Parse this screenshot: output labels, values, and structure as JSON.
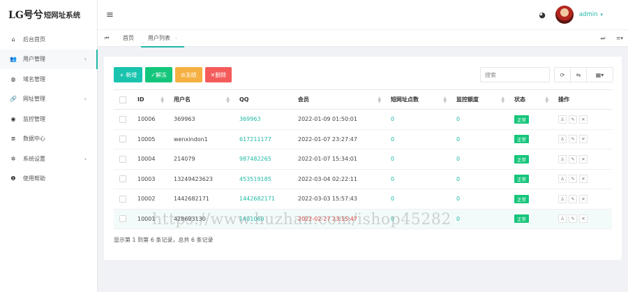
{
  "app": {
    "logo_big": "LG号兮",
    "logo_small": "短网址系统"
  },
  "sidebar": {
    "items": [
      {
        "label": "后台首页",
        "icon": "home-icon",
        "glyph": "⌂",
        "chevron": ""
      },
      {
        "label": "用户管理",
        "icon": "users-icon",
        "glyph": "👥",
        "chevron": "›"
      },
      {
        "label": "域名管理",
        "icon": "globe-icon",
        "glyph": "◍",
        "chevron": ""
      },
      {
        "label": "网址管理",
        "icon": "link-icon",
        "glyph": "🔗",
        "chevron": "›"
      },
      {
        "label": "监控管理",
        "icon": "eye-icon",
        "glyph": "◉",
        "chevron": ""
      },
      {
        "label": "数据中心",
        "icon": "database-icon",
        "glyph": "≣",
        "chevron": ""
      },
      {
        "label": "系统设置",
        "icon": "gear-icon",
        "glyph": "✲",
        "chevron": "›"
      },
      {
        "label": "使用帮助",
        "icon": "info-icon",
        "glyph": "❶",
        "chevron": ""
      }
    ]
  },
  "header": {
    "username": "admin",
    "menu_icon": "≡",
    "palette_icon": "◕",
    "caret": "▾"
  },
  "tabs": {
    "left_icon": "⏮",
    "home_label": "首页",
    "current_label": "用户列表",
    "close_icon": "›",
    "right_icon_1": "⏭",
    "right_icon_2": "≡▾"
  },
  "toolbar": {
    "add_label": "+ 新增",
    "unfreeze_label": "✓解冻",
    "freeze_label": "⊘冻结",
    "delete_label": "✕删除",
    "search_placeholder": "搜索",
    "refresh_icon": "⟳",
    "toggle_icon": "⇋",
    "columns_icon": "▦▾"
  },
  "table": {
    "columns": [
      "",
      "ID",
      "用户名",
      "QQ",
      "会员",
      "短网址点数",
      "监控额度",
      "状态",
      "操作"
    ],
    "status_label": "正常",
    "op_icons": [
      "♙",
      "✎",
      "✕"
    ],
    "rows": [
      {
        "id": "10006",
        "username": "369963",
        "qq": "369963",
        "member": "2022-01-09 01:50:01",
        "points": "0",
        "quota": "0",
        "status": "正常"
      },
      {
        "id": "10005",
        "username": "wenxindon1",
        "qq": "617211177",
        "member": "2022-01-07 23:27:47",
        "points": "0",
        "quota": "0",
        "status": "正常"
      },
      {
        "id": "10004",
        "username": "214079",
        "qq": "987482265",
        "member": "2022-01-07 15:34:01",
        "points": "0",
        "quota": "0",
        "status": "正常"
      },
      {
        "id": "10003",
        "username": "13249423623",
        "qq": "453519185",
        "member": "2022-03-04 02:22:11",
        "points": "0",
        "quota": "0",
        "status": "正常"
      },
      {
        "id": "10002",
        "username": "1442682171",
        "qq": "1442682171",
        "member": "2022-03-03 15:57:43",
        "points": "0",
        "quota": "0",
        "status": "正常"
      },
      {
        "id": "10001",
        "username": "428693130",
        "qq": "1401060",
        "member": "2022-02-27 23:15:47",
        "points": "0",
        "quota": "0",
        "status": "正常"
      }
    ]
  },
  "summary": "显示第 1 到第 6 条记录，总共 6 条记录",
  "watermark": "https://www.huzhan.com/ishop45282",
  "colors": {
    "accent": "#1fb8a7",
    "add": "#19c3ae",
    "unfreeze": "#14c67b",
    "freeze": "#f5b041",
    "delete": "#f45b5b",
    "expired": "#e23b3b"
  }
}
